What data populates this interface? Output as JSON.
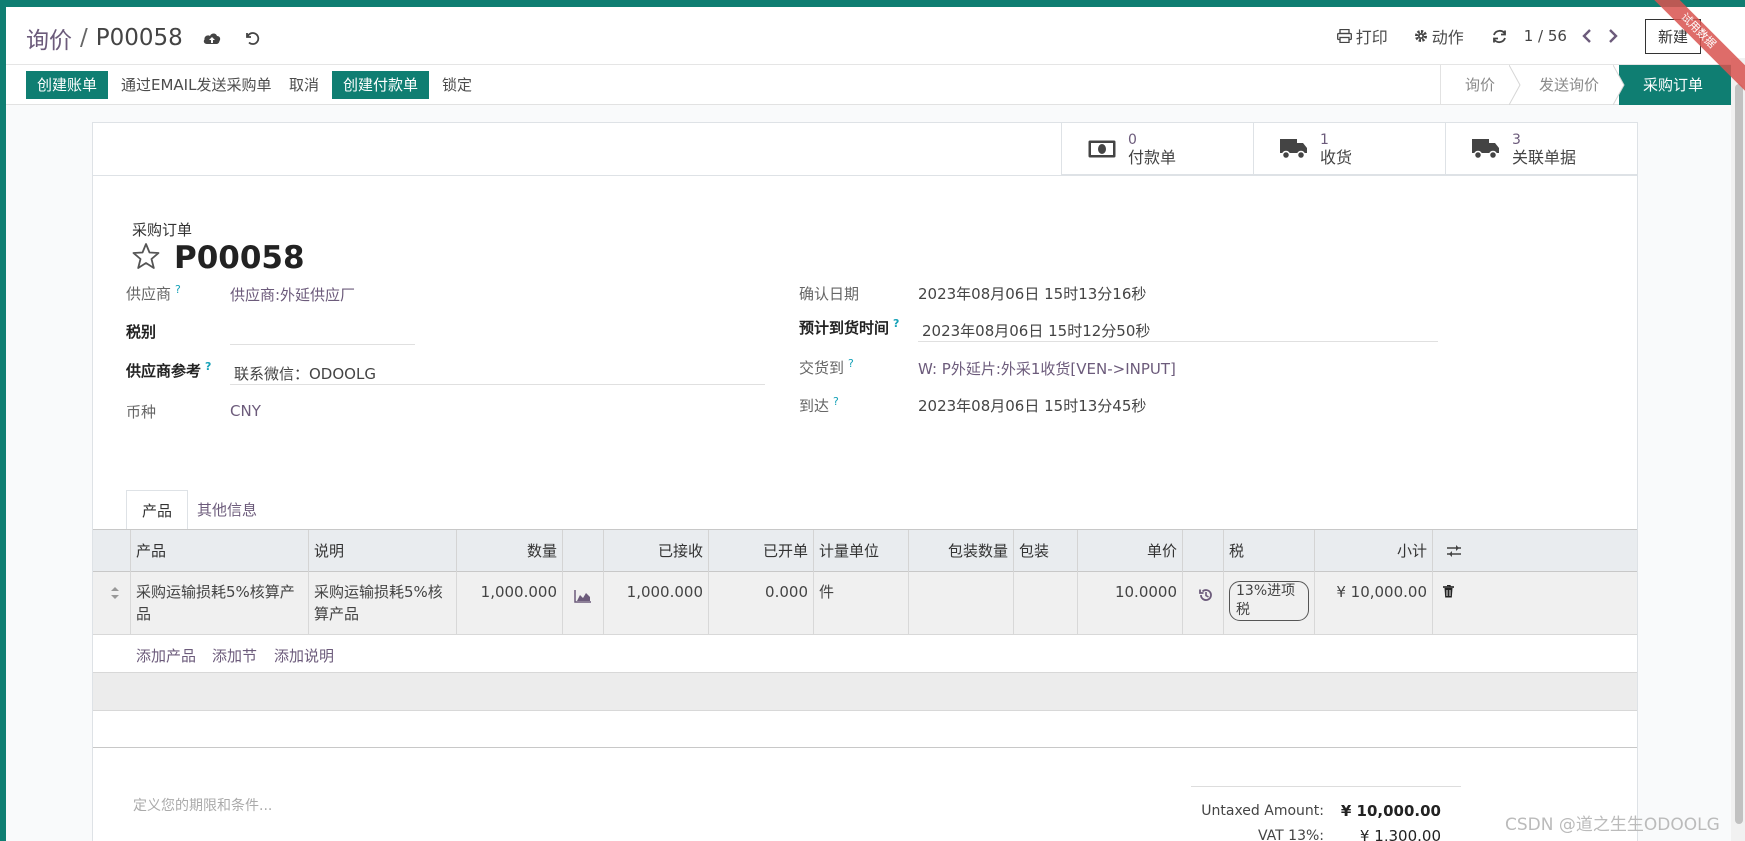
{
  "breadcrumb": {
    "parent": "询价",
    "separator": "/",
    "current": "P00058"
  },
  "toolbar": {
    "print": "打印",
    "action": "动作",
    "pager": "1 / 56",
    "new": "新建"
  },
  "ribbon": "试用数据",
  "actions": {
    "create_bill": "创建账单",
    "send_email": "通过EMAIL发送采购单",
    "cancel": "取消",
    "create_payment": "创建付款单",
    "lock": "锁定"
  },
  "status": {
    "rfq": "询价",
    "rfq_sent": "发送询价",
    "purchase": "采购订单"
  },
  "smart_buttons": [
    {
      "count": "0",
      "label": "付款单",
      "icon": "money-icon"
    },
    {
      "count": "1",
      "label": "收货",
      "icon": "truck-icon"
    },
    {
      "count": "3",
      "label": "关联单据",
      "icon": "truck-icon"
    }
  ],
  "title": {
    "sub": "采购订单",
    "name": "P00058"
  },
  "fields": {
    "vendor_label": "供应商",
    "vendor": "供应商:外延供应厂",
    "tax_label": "税别",
    "tax": "",
    "vendor_ref_label": "供应商参考",
    "vendor_ref": "联系微信：ODOOLG",
    "currency_label": "币种",
    "currency": "CNY",
    "confirm_date_label": "确认日期",
    "confirm_date": "2023年08月06日 15时13分16秒",
    "expected_label": "预计到货时间",
    "expected": "2023年08月06日 15时12分50秒",
    "deliver_to_label": "交货到",
    "deliver_to": "W: P外延片:外采1收货[VEN->INPUT]",
    "arrival_label": "到达",
    "arrival": "2023年08月06日 15时13分45秒"
  },
  "tabs": {
    "products": "产品",
    "other": "其他信息"
  },
  "table": {
    "headers": {
      "product": "产品",
      "description": "说明",
      "qty": "数量",
      "received": "已接收",
      "billed": "已开单",
      "uom": "计量单位",
      "pkg_qty": "包装数量",
      "pkg": "包装",
      "price": "单价",
      "tax": "税",
      "subtotal": "小计"
    },
    "rows": [
      {
        "product": "采购运输损耗5%核算产品",
        "description": "采购运输损耗5%核算产品",
        "qty": "1,000.000",
        "received": "1,000.000",
        "billed": "0.000",
        "uom": "件",
        "pkg_qty": "",
        "pkg": "",
        "price": "10.0000",
        "tax": "13%进项税",
        "subtotal": "¥ 10,000.00"
      }
    ],
    "add_product": "添加产品",
    "add_section": "添加节",
    "add_note": "添加说明"
  },
  "terms_placeholder": "定义您的期限和条件...",
  "totals": {
    "untaxed_label": "Untaxed Amount:",
    "untaxed": "¥ 10,000.00",
    "vat_label": "VAT 13%:",
    "vat": "¥ 1,300.00"
  },
  "watermark": "CSDN @道之生生ODOOLG",
  "colors": {
    "brand": "#0f7e72",
    "link": "#6c5b7b"
  }
}
